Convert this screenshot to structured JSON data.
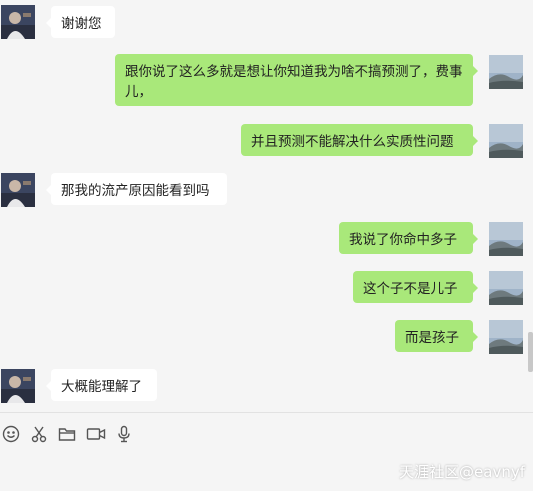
{
  "messages": [
    {
      "side": "in",
      "text": "谢谢您"
    },
    {
      "side": "out",
      "text": "跟你说了这么多就是想让你知道我为啥不搞预测了，费事儿，"
    },
    {
      "side": "out",
      "text": "并且预测不能解决什么实质性问题"
    },
    {
      "side": "in",
      "text": "那我的流产原因能看到吗"
    },
    {
      "side": "out",
      "text": "我说了你命中多子"
    },
    {
      "side": "out",
      "text": "这个子不是儿子"
    },
    {
      "side": "out",
      "text": "而是孩子"
    },
    {
      "side": "in",
      "text": "大概能理解了"
    }
  ],
  "toolbar": {
    "icons": [
      "emoji-icon",
      "scissors-icon",
      "folder-icon",
      "video-icon",
      "microphone-icon"
    ]
  },
  "watermark": "天涯社区@eavnyf",
  "colors": {
    "background": "#f5f5f5",
    "incoming_bubble": "#ffffff",
    "outgoing_bubble": "#a9e87a"
  }
}
